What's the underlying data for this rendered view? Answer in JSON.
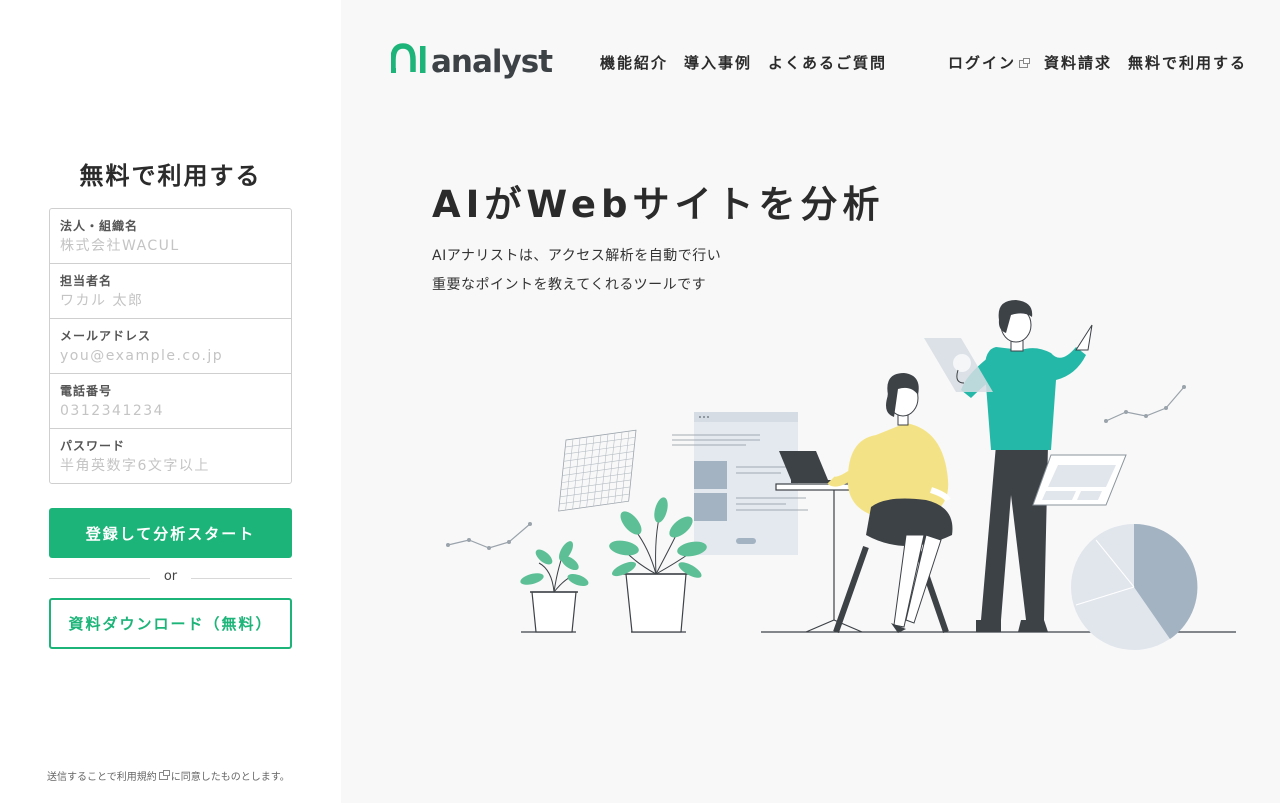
{
  "brand": {
    "logo_ai": "AI",
    "logo_text": "analyst",
    "accent": "#1db479"
  },
  "nav": {
    "features": "機能紹介",
    "cases": "導入事例",
    "faq": "よくあるご質問",
    "login": "ログイン",
    "request_docs": "資料請求",
    "free_trial": "無料で利用する"
  },
  "signup": {
    "title": "無料で利用する",
    "fields": [
      {
        "label": "法人・組織名",
        "placeholder": "株式会社WACUL",
        "value": ""
      },
      {
        "label": "担当者名",
        "placeholder": "ワカル 太郎",
        "value": ""
      },
      {
        "label": "メールアドレス",
        "placeholder": "you@example.co.jp",
        "value": ""
      },
      {
        "label": "電話番号",
        "placeholder": "0312341234",
        "value": ""
      },
      {
        "label": "パスワード",
        "placeholder": "半角英数字6文字以上",
        "value": ""
      }
    ],
    "submit_label": "登録して分析スタート",
    "or_label": "or",
    "download_label": "資料ダウンロード（無料）",
    "terms_before": "送信することで",
    "terms_link": "利用規約",
    "terms_after": "に同意したものとします。"
  },
  "hero": {
    "title": "AIがWebサイトを分析",
    "subtitle_line1": "AIアナリストは、アクセス解析を自動で行い",
    "subtitle_line2": "重要なポイントを教えてくれるツールです"
  },
  "colors": {
    "teal_shirt": "#24b8a8",
    "yellow_top": "#f4e386",
    "dark": "#3d4247",
    "pie_blue": "#a3b3c2",
    "pie_light": "#e1e6ed"
  }
}
